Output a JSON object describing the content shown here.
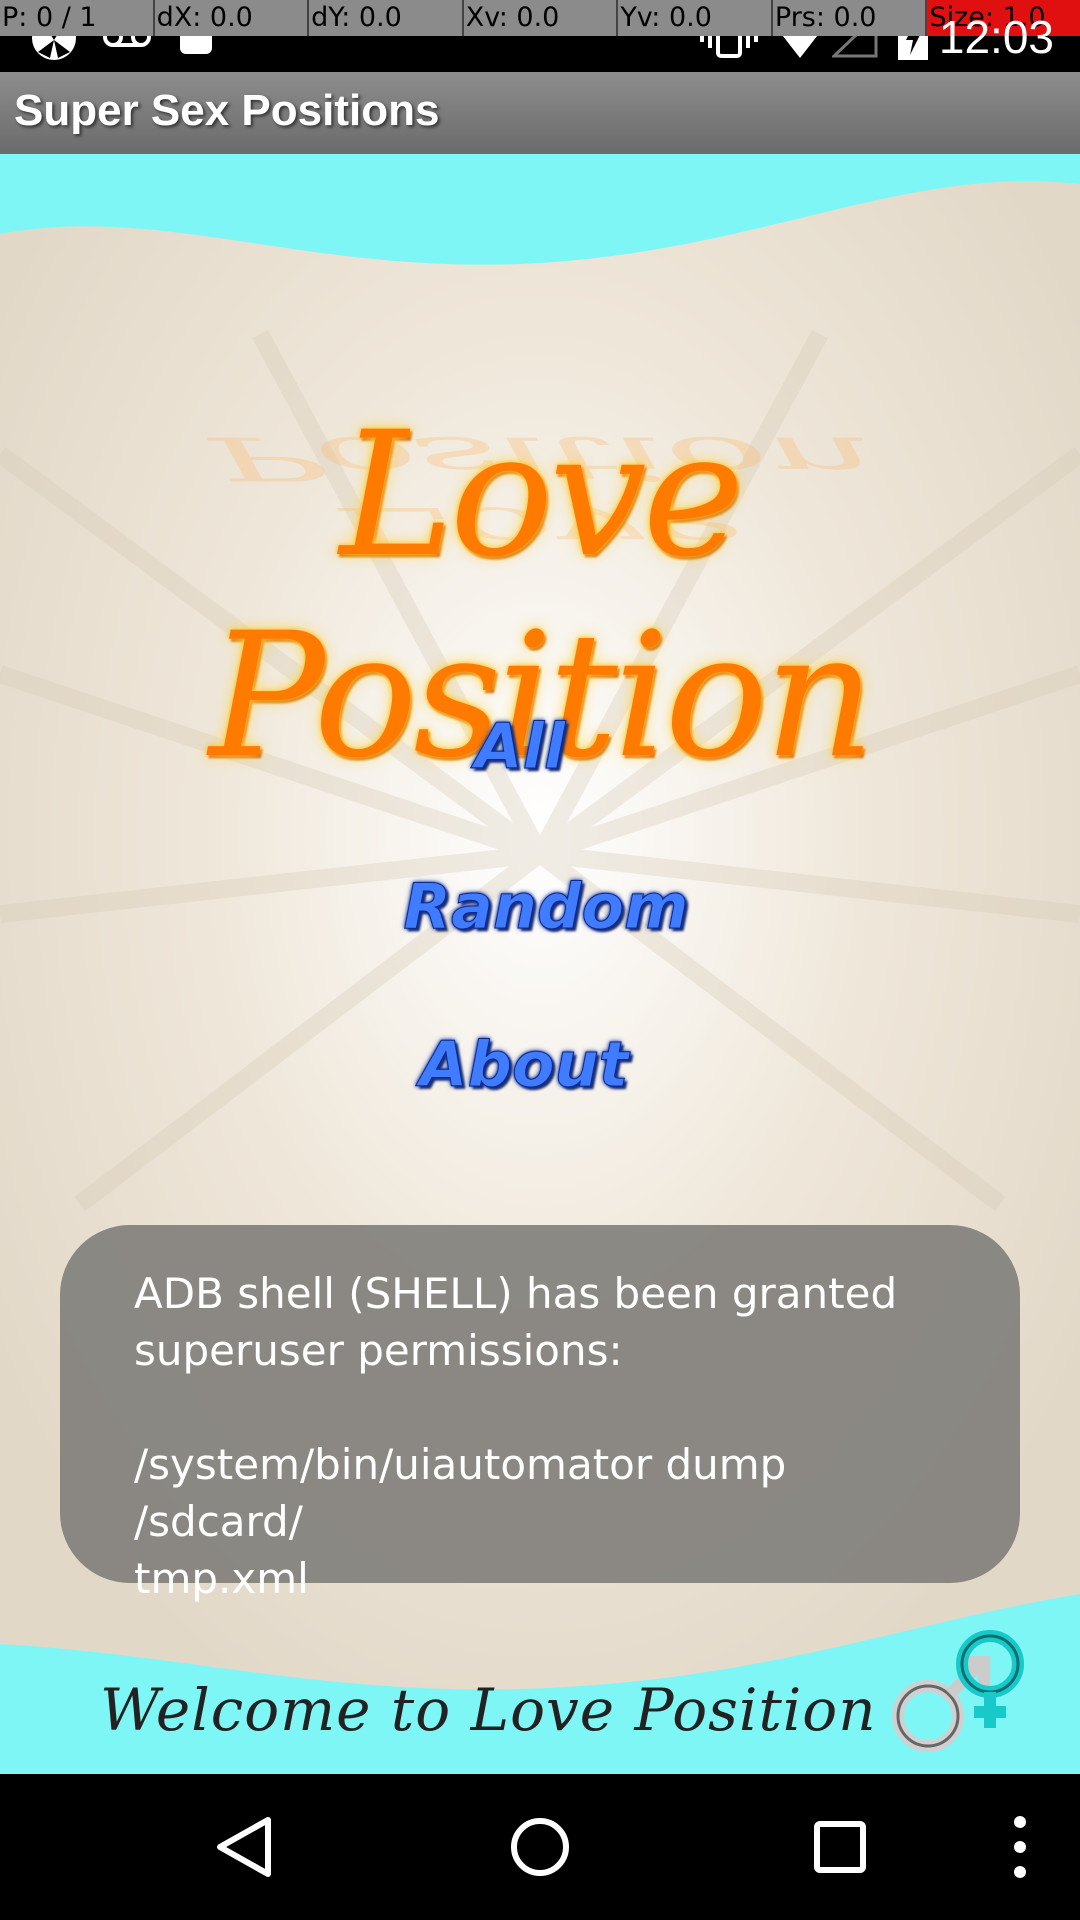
{
  "debug": {
    "p": "P: 0 / 1",
    "dx": "dX: 0.0",
    "dy": "dY: 0.0",
    "xv": "Xv: 0.0",
    "yv": "Yv: 0.0",
    "prs": "Prs: 0.0",
    "size": "Size: 1.0"
  },
  "status_bar": {
    "time": "12:03",
    "icons": [
      "app-notification-icon",
      "voicemail-icon",
      "android-icon",
      "vibrate-icon",
      "wifi-icon",
      "signal-icon",
      "battery-charging-icon"
    ]
  },
  "app_bar": {
    "title": "Super Sex Positions"
  },
  "main": {
    "logo_text": "Love Position",
    "menu": [
      {
        "label": "All"
      },
      {
        "label": "Random"
      },
      {
        "label": "About"
      }
    ],
    "footer_text": "Welcome to Love Position",
    "footer_icon": "male-female-symbol-icon"
  },
  "toast": {
    "line1": "ADB shell (SHELL) has been granted",
    "line2": "superuser permissions:",
    "line3": "/system/bin/uiautomator dump /sdcard/",
    "line4": "tmp.xml"
  },
  "nav_bar": {
    "icons": [
      "back-icon",
      "home-icon",
      "recents-icon",
      "overflow-menu-icon"
    ]
  },
  "colors": {
    "accent_menu": "#3f7cff",
    "logo": "#ff7a00",
    "sky": "#7ff6f6",
    "toast_bg": "#82807c"
  }
}
